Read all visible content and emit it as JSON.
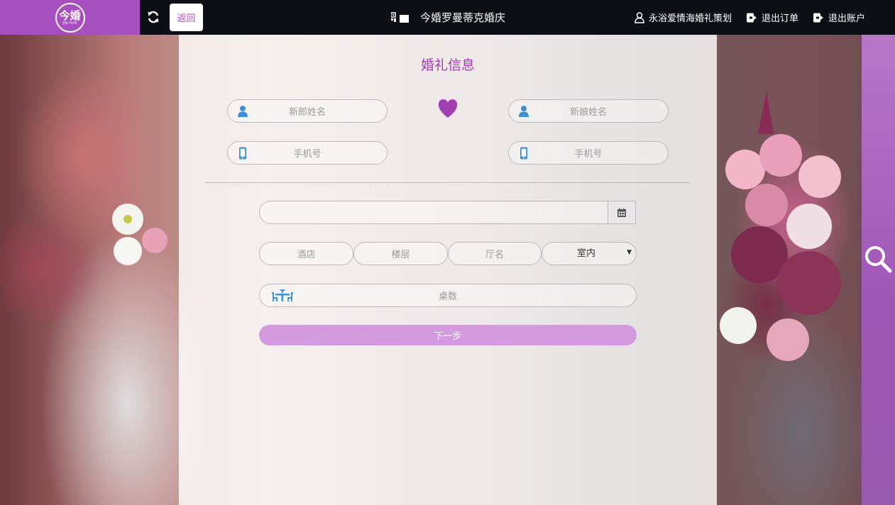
{
  "topbar": {
    "logo_main": "今婚",
    "logo_sub": "JIN HUN",
    "back_label": "返回",
    "shop_title": "今婚罗曼蒂克婚庆",
    "user_name": "永浴爱情海婚礼策划",
    "exit_order_label": "退出订单",
    "exit_account_label": "退出账户"
  },
  "form": {
    "title": "婚礼信息",
    "groom_name_placeholder": "新郎姓名",
    "bride_name_placeholder": "新娘姓名",
    "groom_phone_placeholder": "手机号",
    "bride_phone_placeholder": "手机号",
    "date_value": "",
    "hotel_placeholder": "酒店",
    "floor_placeholder": "楼层",
    "hall_placeholder": "厅名",
    "venue_type_value": "室内",
    "tables_placeholder": "桌数",
    "next_label": "下一步"
  },
  "colors": {
    "brand": "#a84fc0",
    "title": "#a33eb0",
    "next_button": "#d39adf",
    "icon_blue": "#3f8fd6"
  },
  "icons": [
    "refresh-icon",
    "qr-code-icon",
    "user-icon",
    "logout-icon",
    "heart-icon",
    "phone-icon",
    "calendar-icon",
    "table-icon",
    "search-icon"
  ]
}
